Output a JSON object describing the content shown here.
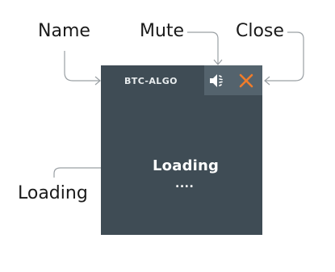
{
  "callouts": {
    "name": "Name",
    "mute": "Mute",
    "close": "Close",
    "loading": "Loading"
  },
  "widget": {
    "name": "BTC-ALGO",
    "loading_text": "Loading",
    "loading_dots": "....",
    "mute_icon": "speaker-mute-icon",
    "close_icon": "close-x-icon",
    "colors": {
      "background": "#3f4c55",
      "control_box": "#54636d",
      "close_accent": "#f07c2a",
      "text": "#ffffff"
    }
  }
}
